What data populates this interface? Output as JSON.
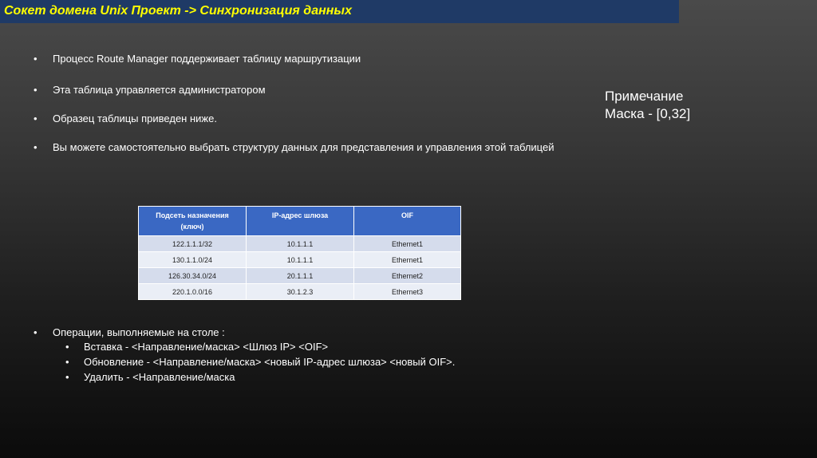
{
  "title": "Сокет домена Unix Проект -> Синхронизация данных",
  "bullets": [
    "Процесс Route Manager поддерживает таблицу маршрутизации",
    "Эта таблица управляется администратором",
    "Образец таблицы приведен ниже.",
    "Вы можете самостоятельно выбрать структуру данных для представления и управления этой таблицей"
  ],
  "bullet_glyph": "•",
  "note": {
    "line1": "Примечание",
    "line2": "Маска - [0,32]"
  },
  "table": {
    "headers": [
      "Подсеть назначения (ключ)",
      "IP-адрес шлюза",
      "OIF"
    ],
    "rows": [
      [
        "122.1.1.1/32",
        "10.1.1.1",
        "Ethernet1"
      ],
      [
        "130.1.1.0/24",
        "10.1.1.1",
        "Ethernet1"
      ],
      [
        "126.30.34.0/24",
        "20.1.1.1",
        "Ethernet2"
      ],
      [
        "220.1.0.0/16",
        "30.1.2.3",
        "Ethernet3"
      ]
    ]
  },
  "operations": {
    "heading": "Операции, выполняемые на столе :",
    "items": [
      "Вставка - <Направление/маска> <Шлюз IP> <OIF>",
      "Обновление - <Направление/маска> <новый IP-адрес шлюза> <новый OIF>.",
      "Удалить - <Направление/маска"
    ]
  },
  "colors": {
    "title_bar": "#1f3a66",
    "title_text": "#ffff00",
    "table_header": "#3a68c3",
    "table_row_odd": "#d5dcec",
    "table_row_even": "#eaeef6"
  }
}
